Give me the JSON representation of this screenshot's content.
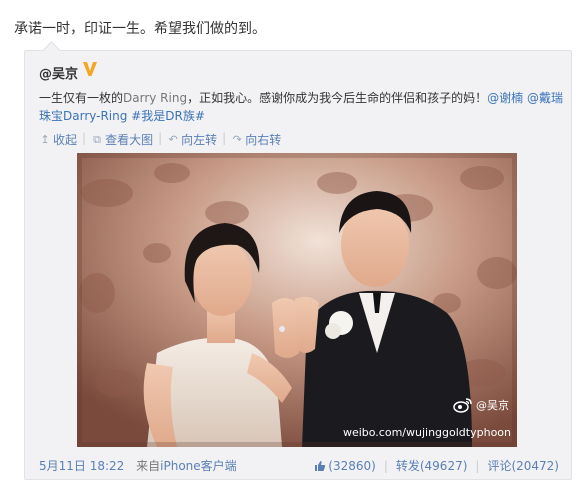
{
  "post": {
    "text": "承诺一时，印证一生。希望我们做的到。"
  },
  "repost": {
    "author": "@吴京",
    "verified_icon": "verified-v-icon",
    "line1_a": "一生仅有一枚的",
    "line1_brand": "Darry Ring",
    "line1_b": "，正如我心。感谢你成为我今后生命的伴侣和孩子的妈！",
    "mention1": "@谢楠",
    "mention2": "@戴瑞",
    "line2_a": "珠宝Darry-Ring",
    "tag": "#我是DR族#",
    "actions": {
      "collapse": "收起",
      "view_large": "查看大图",
      "rotate_left": "向左转",
      "rotate_right": "向右转"
    },
    "image": {
      "watermark_name": "@吴京",
      "watermark_url": "weibo.com/wujinggoldtyphoon"
    },
    "footer": {
      "date": "5月11日 18:22",
      "from": "来自",
      "source": "iPhone客户端",
      "likes": "(32860)",
      "reposts": "转发(49627)",
      "comments": "评论(20472)"
    }
  },
  "colors": {
    "link": "#3b73b9",
    "card_bg": "#f2f2f5",
    "verified": "#f5a623"
  }
}
